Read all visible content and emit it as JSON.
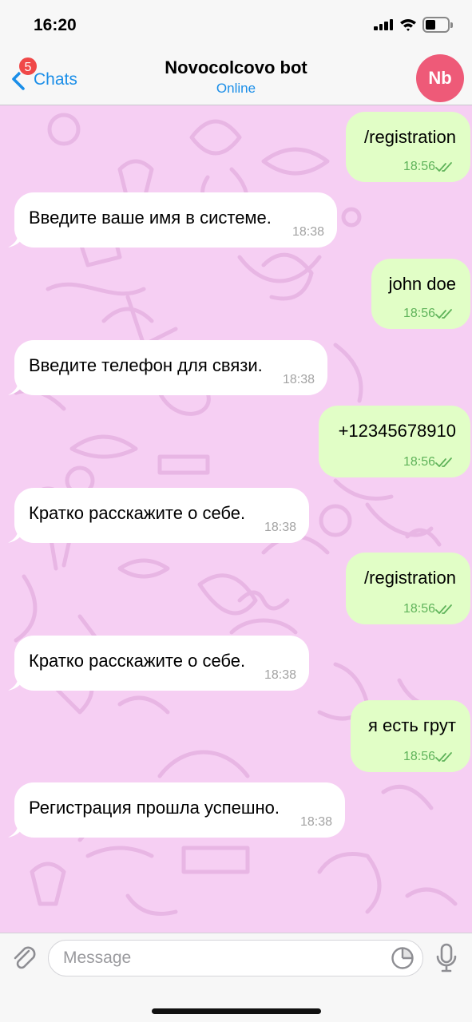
{
  "status_bar": {
    "time": "16:20"
  },
  "nav": {
    "back_label": "Chats",
    "unread_badge": "5",
    "title": "Novocolcovo bot",
    "status": "Online",
    "avatar_initials": "Nb"
  },
  "messages": [
    {
      "direction": "out",
      "text": "/registration",
      "time": "18:56"
    },
    {
      "direction": "in",
      "text": "Введите ваше имя в системе.",
      "time": "18:38"
    },
    {
      "direction": "out",
      "text": "john doe",
      "time": "18:56"
    },
    {
      "direction": "in",
      "text": "Введите телефон для связи.",
      "time": "18:38"
    },
    {
      "direction": "out",
      "text": "+12345678910",
      "time": "18:56"
    },
    {
      "direction": "in",
      "text": "Кратко расскажите о себе.",
      "time": "18:38"
    },
    {
      "direction": "out",
      "text": "/registration",
      "time": "18:56"
    },
    {
      "direction": "in",
      "text": "Кратко расскажите о себе.",
      "time": "18:38"
    },
    {
      "direction": "out",
      "text": "я есть грут",
      "time": "18:56"
    },
    {
      "direction": "in",
      "text": "Регистрация прошла успешно.",
      "time": "18:38"
    }
  ],
  "input": {
    "placeholder": "Message",
    "value": ""
  },
  "icons": {
    "back": "chevron-left-icon",
    "attach": "paperclip-icon",
    "sticker": "sticker-icon",
    "mic": "microphone-icon",
    "read_receipt": "double-check-icon"
  },
  "colors": {
    "accent": "#1a8ee8",
    "badge": "#f04848",
    "avatar": "#ee5a78",
    "chat_background": "#f6cff3",
    "outgoing_bubble": "#e1fec6",
    "incoming_bubble": "#ffffff",
    "read_check": "#5fb35a"
  }
}
